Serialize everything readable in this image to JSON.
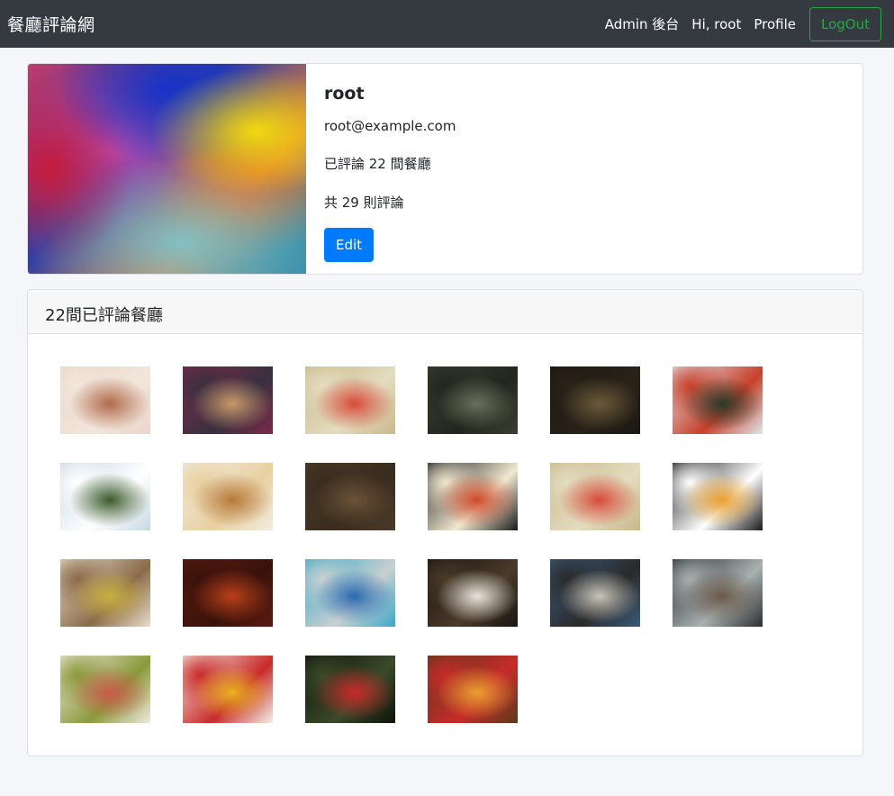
{
  "navbar": {
    "brand": "餐廳評論網",
    "admin_link": "Admin 後台",
    "greeting": "Hi, root",
    "profile_link": "Profile",
    "logout_label": "LogOut"
  },
  "profile": {
    "name": "root",
    "email": "root@example.com",
    "restaurants_reviewed": "已評論 22 間餐廳",
    "total_comments": "共 29 則評論",
    "edit_label": "Edit"
  },
  "reviewed": {
    "header": "22間已評論餐廳",
    "thumbnails": [
      {
        "name": "restaurant-thumb-1",
        "colors": [
          "#e9d6c8",
          "#b06a4a",
          "#f2e6dc"
        ]
      },
      {
        "name": "restaurant-thumb-2",
        "colors": [
          "#7a2a4a",
          "#c79a6a",
          "#3a3040"
        ]
      },
      {
        "name": "restaurant-thumb-3",
        "colors": [
          "#c8b88a",
          "#d74a3a",
          "#e4dcc0"
        ]
      },
      {
        "name": "restaurant-thumb-4",
        "colors": [
          "#3a3e30",
          "#6a6e5a",
          "#23261e"
        ]
      },
      {
        "name": "restaurant-thumb-5",
        "colors": [
          "#1a1712",
          "#6a5a3a",
          "#2a2218"
        ]
      },
      {
        "name": "restaurant-thumb-6",
        "colors": [
          "#dfe6ea",
          "#2a3a2a",
          "#c8402a"
        ]
      },
      {
        "name": "restaurant-thumb-7",
        "colors": [
          "#c8d8e4",
          "#3a5a2a",
          "#ffffff"
        ]
      },
      {
        "name": "restaurant-thumb-8",
        "colors": [
          "#f2ece2",
          "#b87a3a",
          "#e8d0a0"
        ]
      },
      {
        "name": "restaurant-thumb-9",
        "colors": [
          "#4a3a28",
          "#6a5238",
          "#3a2c1e"
        ]
      },
      {
        "name": "restaurant-thumb-10",
        "colors": [
          "#1a1a1a",
          "#d04a2a",
          "#f0e8d0"
        ]
      },
      {
        "name": "restaurant-thumb-11",
        "colors": [
          "#c8b88a",
          "#d74a3a",
          "#e4dcc0"
        ]
      },
      {
        "name": "restaurant-thumb-12",
        "colors": [
          "#1a1a1a",
          "#e8a030",
          "#ffffff"
        ]
      },
      {
        "name": "restaurant-thumb-13",
        "colors": [
          "#e8dcc8",
          "#c8b040",
          "#8a6a4a"
        ]
      },
      {
        "name": "restaurant-thumb-14",
        "colors": [
          "#5a1a10",
          "#b8401a",
          "#3a120a"
        ]
      },
      {
        "name": "restaurant-thumb-15",
        "colors": [
          "#3aa8c8",
          "#2a6ab0",
          "#c8d0d0"
        ]
      },
      {
        "name": "restaurant-thumb-16",
        "colors": [
          "#1a1410",
          "#e8e4dc",
          "#4a3a2a"
        ]
      },
      {
        "name": "restaurant-thumb-17",
        "colors": [
          "#3a5a7a",
          "#c8c4b8",
          "#2a2a2a"
        ]
      },
      {
        "name": "restaurant-thumb-18",
        "colors": [
          "#2a2e30",
          "#6a5a4a",
          "#a8b0b0"
        ]
      },
      {
        "name": "restaurant-thumb-19",
        "colors": [
          "#f0e8e0",
          "#c85a4a",
          "#8a9a3a"
        ]
      },
      {
        "name": "restaurant-thumb-20",
        "colors": [
          "#f4f0e8",
          "#e8b020",
          "#c82a2a"
        ]
      },
      {
        "name": "restaurant-thumb-21",
        "colors": [
          "#0e1208",
          "#c82a2a",
          "#3a4a2a"
        ]
      },
      {
        "name": "restaurant-thumb-22",
        "colors": [
          "#5a3a1a",
          "#e8a030",
          "#c82a2a"
        ]
      }
    ]
  }
}
